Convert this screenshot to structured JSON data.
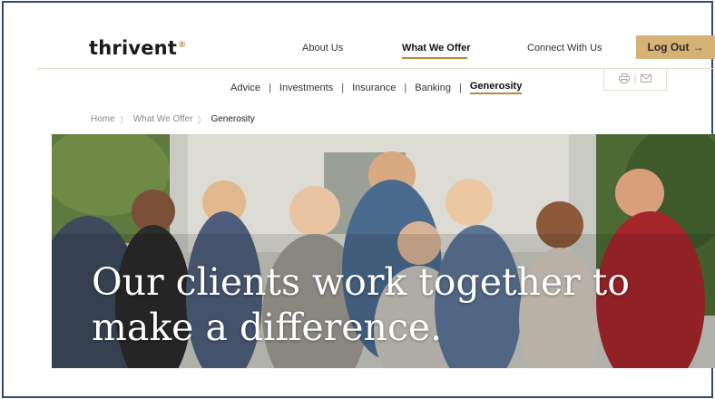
{
  "brand": {
    "logo_text": "thrivent",
    "logo_mark": "®",
    "accent_color": "#d7b277"
  },
  "topnav": {
    "about": "About Us",
    "offer": "What We Offer",
    "connect": "Connect With Us",
    "logout": "Log Out",
    "logout_icon": "arrow-right-icon"
  },
  "subnav": {
    "items": [
      "Advice",
      "Investments",
      "Insurance",
      "Banking",
      "Generosity"
    ],
    "active": "Generosity",
    "separator": "|"
  },
  "utilities": {
    "print_icon": "print-icon",
    "email_icon": "email-icon",
    "separator": "|"
  },
  "breadcrumb": {
    "home": "Home",
    "section": "What We Offer",
    "current": "Generosity"
  },
  "hero": {
    "line1": "Our clients work together to",
    "line2": "make a difference."
  }
}
